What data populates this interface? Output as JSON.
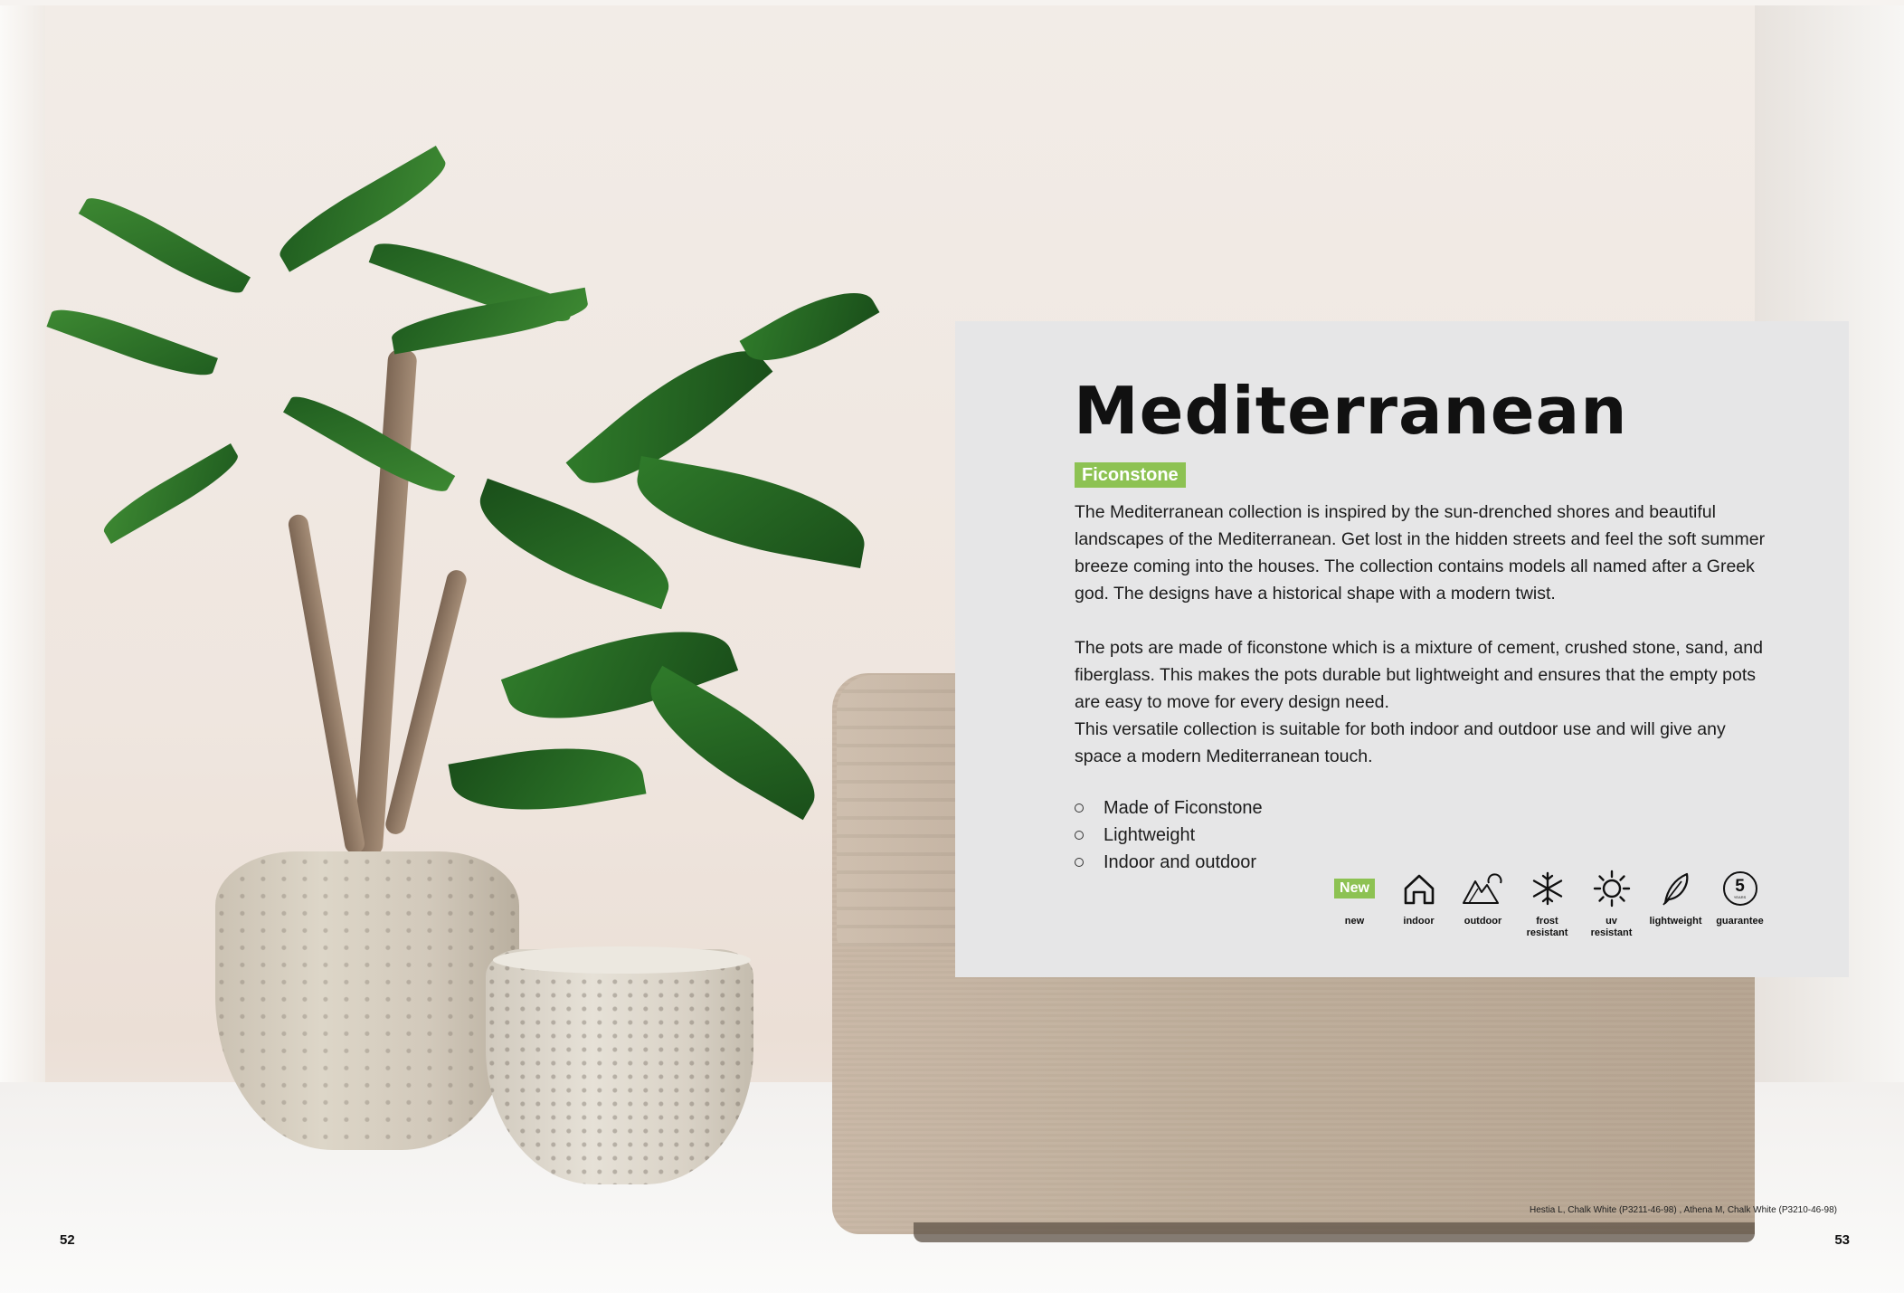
{
  "page": {
    "title": "Mediterranean",
    "material_tag": "Ficonstone",
    "paragraphs": [
      "The Mediterranean collection is inspired by the sun-drenched shores and beautiful landscapes of the Mediterranean. Get lost in the hidden streets and feel the soft summer breeze coming into the houses. The collection contains models all named after a Greek god. The designs have a historical shape with a modern twist.",
      "The pots are made of ficonstone which is a mixture of cement, crushed stone, sand, and fiberglass. This makes the pots durable but lightweight and ensures that the empty pots are easy to move for every design need.",
      "This versatile collection is suitable for both indoor and outdoor use and will give any space a modern Mediterranean touch."
    ],
    "bullets": [
      "Made of Ficonstone",
      "Lightweight",
      "Indoor and outdoor"
    ],
    "features": {
      "new_badge": "New",
      "labels": [
        "new",
        "indoor",
        "outdoor",
        "frost resistant",
        "uv resistant",
        "lightweight",
        "guarantee"
      ],
      "guarantee_number": "5",
      "guarantee_small": "YEARS"
    },
    "caption": "Hestia L, Chalk White (P3211-46-98) , Athena M, Chalk White (P3210-46-98)",
    "page_left": "52",
    "page_right": "53"
  },
  "colors": {
    "accent_green": "#8dc253",
    "panel_bg": "#e6e6e7",
    "text": "#111111"
  },
  "icons": [
    "house-icon",
    "mountain-sun-icon",
    "snowflake-icon",
    "sun-icon",
    "feather-icon",
    "guarantee-badge-icon"
  ]
}
